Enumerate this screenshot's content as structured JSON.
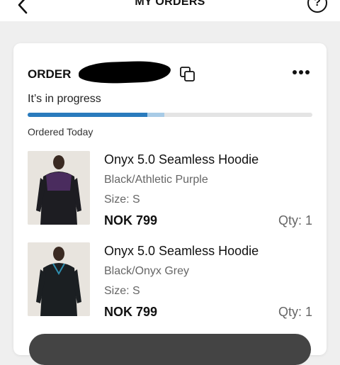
{
  "header": {
    "title": "MY ORDERS",
    "back_icon": "chevron-left-icon",
    "help_icon": "question-circle-icon",
    "help_glyph": "?"
  },
  "order": {
    "label": "ORDER",
    "status": "It’s in progress",
    "progress": 0.42,
    "ordered": "Ordered Today",
    "accent_color": "#2a7bbd",
    "items": [
      {
        "name": "Onyx 5.0 Seamless Hoodie",
        "color": "Black/Athletic Purple",
        "size": "Size: S",
        "price": "NOK 799",
        "qty": "Qty: 1",
        "accent": "#4a2c5e"
      },
      {
        "name": "Onyx 5.0 Seamless Hoodie",
        "color": "Black/Onyx Grey",
        "size": "Size: S",
        "price": "NOK 799",
        "qty": "Qty: 1",
        "accent": "#2f8fb0"
      }
    ]
  }
}
